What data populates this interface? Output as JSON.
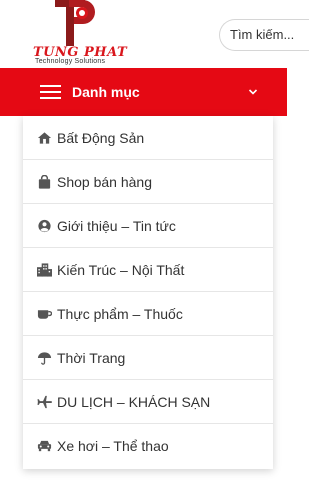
{
  "brand": {
    "name": "TUNG PHAT",
    "tagline": "Technology Solutions",
    "color": "#d9161c"
  },
  "search": {
    "placeholder": "Tìm kiếm..."
  },
  "menu": {
    "title": "Danh mục",
    "bar_color": "#e50914",
    "items": [
      {
        "label": "Bất Động Sản",
        "icon": "house-icon"
      },
      {
        "label": "Shop bán hàng",
        "icon": "shopping-bag-icon"
      },
      {
        "label": "Giới thiệu – Tin tức",
        "icon": "user-circle-icon"
      },
      {
        "label": "Kiến Trúc – Nội Thất",
        "icon": "building-icon"
      },
      {
        "label": "Thực phẩm – Thuốc",
        "icon": "coffee-cup-icon"
      },
      {
        "label": "Thời Trang",
        "icon": "umbrella-icon"
      },
      {
        "label": "DU LỊCH – KHÁCH SẠN",
        "icon": "plane-icon"
      },
      {
        "label": "Xe hơi – Thể thao",
        "icon": "car-icon"
      }
    ]
  }
}
